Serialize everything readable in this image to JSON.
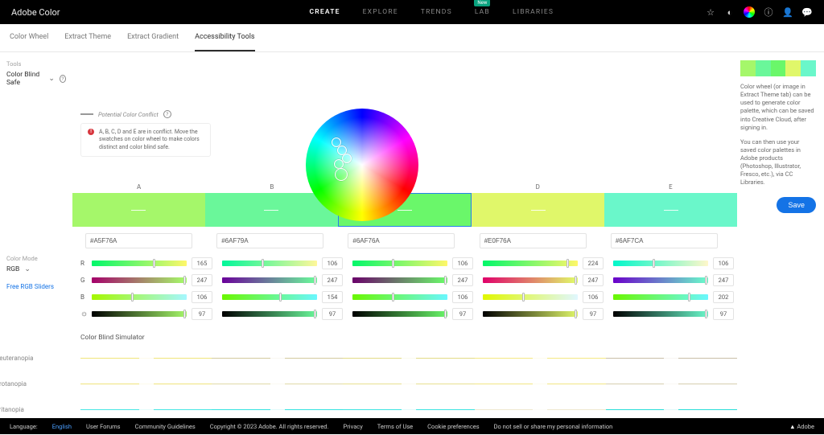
{
  "brand": "Adobe Color",
  "nav": {
    "create": "CREATE",
    "explore": "EXPLORE",
    "trends": "TRENDS",
    "lab": "LAB",
    "libraries": "LIBRARIES",
    "new": "New"
  },
  "subnav": {
    "wheel": "Color Wheel",
    "extract": "Extract Theme",
    "gradient": "Extract Gradient",
    "access": "Accessibility Tools"
  },
  "tools_label": "Tools",
  "tool_name": "Color Blind Safe",
  "legend": "Potential Color Conflict",
  "warning": "A, B, C, D and E are in conflict. Move the swatches on color wheel to make colors distinct and color blind safe.",
  "swatch_labels": [
    "A",
    "B",
    "C",
    "D",
    "E"
  ],
  "colors": [
    "#A5F76A",
    "#6AF79A",
    "#6AF76A",
    "#E0F76A",
    "#6AF7CA"
  ],
  "rgb": [
    {
      "r": 165,
      "g": 247,
      "b": 106
    },
    {
      "r": 106,
      "g": 247,
      "b": 154
    },
    {
      "r": 106,
      "g": 247,
      "b": 106
    },
    {
      "r": 224,
      "g": 247,
      "b": 106
    },
    {
      "r": 106,
      "g": 247,
      "b": 202
    }
  ],
  "brightness": [
    97,
    97,
    97,
    97,
    97
  ],
  "color_mode_label": "Color Mode",
  "color_mode": "RGB",
  "free_sliders": "Free RGB Sliders",
  "channel_r": "R",
  "channel_g": "G",
  "channel_b": "B",
  "cbs_title": "Color Blind Simulator",
  "cbs": {
    "deut": {
      "label": "Deuteranopia",
      "colors": [
        "#f0e57a",
        "#d3ca9e",
        "#e3da86",
        "#f4e883",
        "#c8bea7"
      ]
    },
    "prot": {
      "label": "Protanopia",
      "colors": [
        "#efe37b",
        "#e0d9a6",
        "#e8df8f",
        "#f1e684",
        "#d6cfae"
      ]
    },
    "trit": {
      "label": "Tritanopia",
      "colors": [
        "#49e7e4",
        "#35e3e0",
        "#3ee5e2",
        "#efe9d0",
        "#2aded9"
      ]
    }
  },
  "right": {
    "p1": "Color wheel (or image in Extract Theme tab) can be used to generate color palette, which can be saved into Creative Cloud, after signing in.",
    "p2": "You can then use your saved color palettes in Adobe products (Photoshop, Illustrator, Fresco, etc.), via CC Libraries.",
    "save": "Save"
  },
  "footer": {
    "lang_label": "Language:",
    "lang": "English",
    "forums": "User Forums",
    "guide": "Community Guidelines",
    "copy": "Copyright © 2023 Adobe. All rights reserved.",
    "privacy": "Privacy",
    "terms": "Terms of Use",
    "cookies": "Cookie preferences",
    "donot": "Do not sell or share my personal information",
    "adobe": "Adobe"
  }
}
